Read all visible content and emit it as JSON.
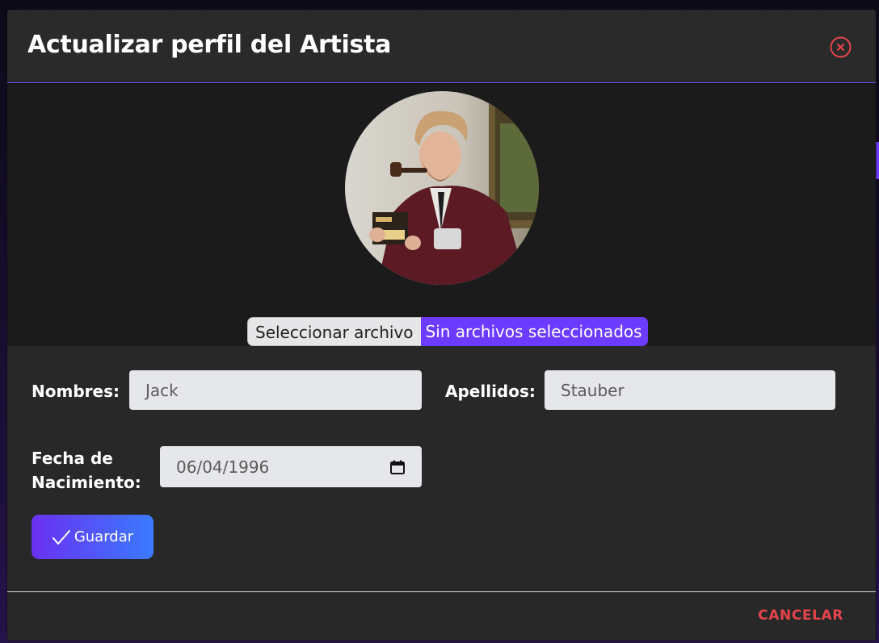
{
  "modal": {
    "title": "Actualizar perfil del Artista",
    "close_icon": "close-circle-icon"
  },
  "photo": {
    "avatar_alt": "artist-photo",
    "file_button_label": "Seleccionar archivo",
    "file_status": "Sin archivos seleccionados"
  },
  "form": {
    "nombres_label": "Nombres:",
    "nombres_value": "Jack",
    "apellidos_label": "Apellidos:",
    "apellidos_value": "Stauber",
    "fecha_label_line1": "Fecha de",
    "fecha_label_line2": "Nacimiento:",
    "fecha_value": "06/04/1996",
    "calendar_icon": "calendar-icon",
    "save_icon": "checkmark-icon",
    "save_label": "Guardar"
  },
  "footer": {
    "cancel_label": "CANCELAR"
  },
  "colors": {
    "accent": "#6b3cff",
    "danger": "#e5454a",
    "modal_bg": "#282828",
    "photo_bg": "#1b1b1b"
  }
}
